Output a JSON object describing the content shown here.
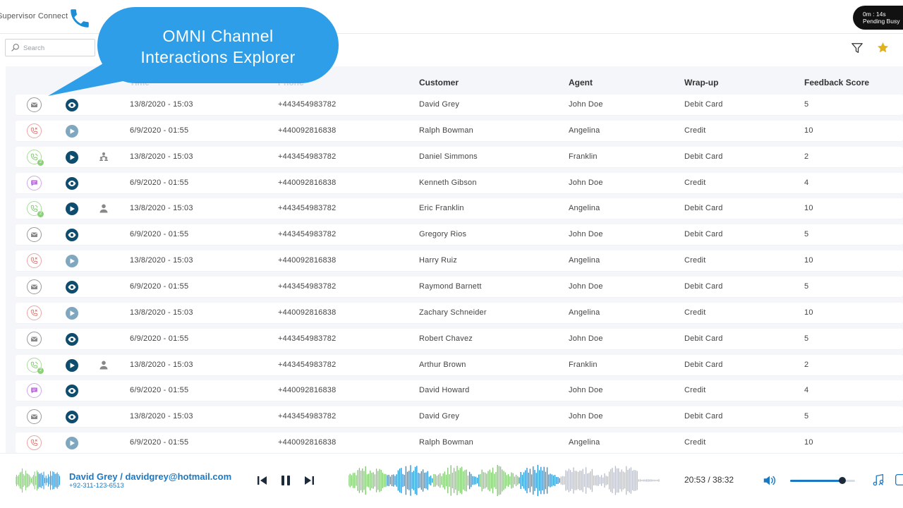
{
  "app": {
    "title": "Supervisor Connect"
  },
  "status": {
    "timer": "0m : 14s",
    "state": "Pending Busy"
  },
  "search": {
    "placeholder": "Search"
  },
  "tooltip": {
    "line1": "OMNI Channel",
    "line2": "Interactions Explorer"
  },
  "table": {
    "headers": {
      "time": "Time",
      "phone": "Phone",
      "customer": "Customer",
      "agent": "Agent",
      "wrapup": "Wrap-up",
      "feedback": "Feedback Score"
    },
    "rows": [
      {
        "channel": "email",
        "action": "view",
        "person": "",
        "time": "13/8/2020 - 15:03",
        "phone": "+443454983782",
        "customer": "David Grey",
        "agent": "John Doe",
        "wrapup": "Debit Card",
        "score": "5"
      },
      {
        "channel": "missed-call",
        "action": "play-disabled",
        "person": "",
        "time": "6/9/2020 - 01:55",
        "phone": "+440092816838",
        "customer": "Ralph Bowman",
        "agent": "Angelina",
        "wrapup": "Credit",
        "score": "10"
      },
      {
        "channel": "call",
        "badge": "2",
        "action": "play",
        "person": "group",
        "time": "13/8/2020 - 15:03",
        "phone": "+443454983782",
        "customer": "Daniel Simmons",
        "agent": "Franklin",
        "wrapup": "Debit Card",
        "score": "2"
      },
      {
        "channel": "chat",
        "action": "view",
        "person": "",
        "time": "6/9/2020 - 01:55",
        "phone": "+440092816838",
        "customer": "Kenneth Gibson",
        "agent": "John Doe",
        "wrapup": "Credit",
        "score": "4"
      },
      {
        "channel": "call",
        "badge": "2",
        "action": "play",
        "person": "single",
        "time": "13/8/2020 - 15:03",
        "phone": "+443454983782",
        "customer": "Eric Franklin",
        "agent": "Angelina",
        "wrapup": "Debit Card",
        "score": "10"
      },
      {
        "channel": "email",
        "action": "view",
        "person": "",
        "time": "6/9/2020 - 01:55",
        "phone": "+443454983782",
        "customer": "Gregory Rios",
        "agent": "John Doe",
        "wrapup": "Debit Card",
        "score": "5"
      },
      {
        "channel": "missed-call",
        "action": "play-disabled",
        "person": "",
        "time": "13/8/2020 - 15:03",
        "phone": "+440092816838",
        "customer": "Harry Ruiz",
        "agent": "Angelina",
        "wrapup": "Credit",
        "score": "10"
      },
      {
        "channel": "email",
        "action": "view",
        "person": "",
        "time": "6/9/2020 - 01:55",
        "phone": "+443454983782",
        "customer": "Raymond Barnett",
        "agent": "John Doe",
        "wrapup": "Debit Card",
        "score": "5"
      },
      {
        "channel": "missed-call",
        "action": "play-disabled",
        "person": "",
        "time": "13/8/2020 - 15:03",
        "phone": "+440092816838",
        "customer": "Zachary Schneider",
        "agent": "Angelina",
        "wrapup": "Credit",
        "score": "10"
      },
      {
        "channel": "email",
        "action": "view",
        "person": "",
        "time": "6/9/2020 - 01:55",
        "phone": "+443454983782",
        "customer": "Robert Chavez",
        "agent": "John Doe",
        "wrapup": "Debit Card",
        "score": "5"
      },
      {
        "channel": "call",
        "badge": "2",
        "action": "play",
        "person": "single",
        "time": "13/8/2020 - 15:03",
        "phone": "+443454983782",
        "customer": "Arthur Brown",
        "agent": "Franklin",
        "wrapup": "Debit Card",
        "score": "2"
      },
      {
        "channel": "chat",
        "action": "view",
        "person": "",
        "time": "6/9/2020 - 01:55",
        "phone": "+440092816838",
        "customer": "David Howard",
        "agent": "John Doe",
        "wrapup": "Credit",
        "score": "4"
      },
      {
        "channel": "email",
        "action": "view",
        "person": "",
        "time": "13/8/2020 - 15:03",
        "phone": "+443454983782",
        "customer": "David Grey",
        "agent": "John Doe",
        "wrapup": "Debit Card",
        "score": "5"
      },
      {
        "channel": "missed-call",
        "action": "play-disabled",
        "person": "",
        "time": "6/9/2020 - 01:55",
        "phone": "+440092816838",
        "customer": "Ralph Bowman",
        "agent": "Angelina",
        "wrapup": "Credit",
        "score": "10"
      }
    ]
  },
  "player": {
    "caller": "David Grey / davidgrey@hotmail.com",
    "caller_phone": "+92-311-123-6513",
    "time": "20:53 / 38:32",
    "volume": 0.8,
    "state": "playing"
  },
  "colors": {
    "accent": "#1b78c2",
    "bubble": "#2e9ee8",
    "email": "#888888",
    "missed": "#e8736f",
    "call": "#7cc96a",
    "chat": "#b56fd6",
    "action_dark": "#0e4d6d",
    "action_light": "#7fa7bf",
    "star": "#e2b21d",
    "wave_green": "#7cc96a",
    "wave_blue": "#1f8fd6",
    "wave_grey": "#b9bcc6"
  }
}
